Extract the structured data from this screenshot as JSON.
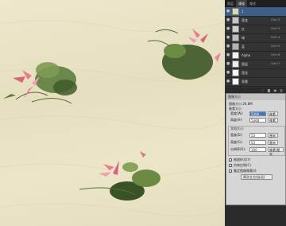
{
  "panel_tabs": [
    "图层",
    "通道",
    "路径"
  ],
  "layers": [
    {
      "name": "1",
      "key": "",
      "selected": true
    },
    {
      "name": "莲花",
      "key": "Ctrl+2",
      "selected": false
    },
    {
      "name": "红",
      "key": "Ctrl+3",
      "selected": false
    },
    {
      "name": "绿",
      "key": "Ctrl+4",
      "selected": false
    },
    {
      "name": "蓝",
      "key": "Ctrl+5",
      "selected": false
    },
    {
      "name": "Alpha",
      "key": "Ctrl+6",
      "selected": false
    },
    {
      "name": "图层",
      "key": "Ctrl+7",
      "selected": false
    },
    {
      "name": "莲花",
      "key": "",
      "selected": false
    },
    {
      "name": "背景",
      "key": "",
      "selected": false
    }
  ],
  "dialog": {
    "title": "图像大小",
    "size_label": "图像大小:26.8M",
    "pixel_group": "像素大小",
    "width_label": "宽度(W):",
    "width_value": "5300",
    "width_unit": "像素",
    "height_label": "高度(H):",
    "height_value": "5300",
    "height_unit": "像素",
    "doc_group": "文档大小:",
    "doc_width_label": "宽度(D):",
    "doc_width_value": "53",
    "doc_width_unit": "厘米",
    "doc_height_label": "高度(G):",
    "doc_height_value": "53",
    "doc_height_unit": "厘米",
    "res_label": "分辨率(R):",
    "res_value": "100",
    "res_unit": "像素/厘米",
    "scale_styles": "缩放样式(Y)",
    "constrain": "约束比例(C)",
    "resample": "重定图像像素(I):",
    "method": "两次立方(自动)"
  },
  "colors": {
    "canvas": "#e9e3c4",
    "panel": "#2b2b2b",
    "selection": "#3d5f86",
    "dialog": "#d6d6d6"
  }
}
